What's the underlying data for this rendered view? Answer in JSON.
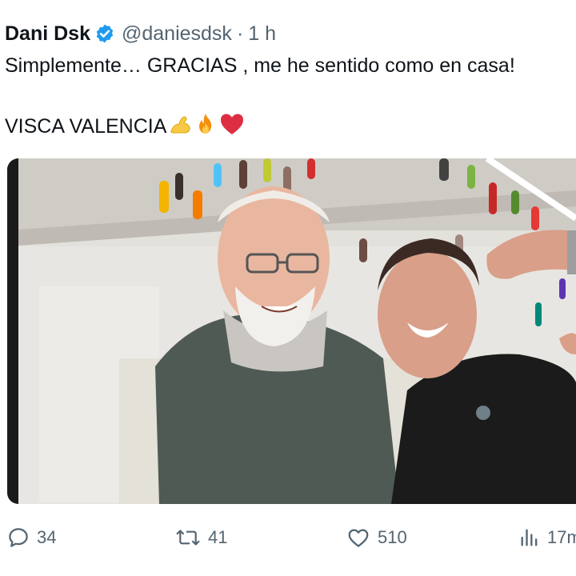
{
  "tweet": {
    "author_name": "Dani Dsk",
    "handle": "@daniesdsk",
    "separator": "·",
    "time": "1 h",
    "text_line1": "Simplemente… GRACIAS , me he sentido como en casa!",
    "text_line2": "VISCA VALENCIA",
    "emojis": [
      "flexed-biceps-icon",
      "fire-icon",
      "red-heart-icon"
    ]
  },
  "media": {
    "description_icon": "photo"
  },
  "actions": {
    "replies": "34",
    "reposts": "41",
    "likes": "510",
    "views": "17m"
  },
  "colors": {
    "text": "#0f1419",
    "secondary": "#536471",
    "verified": "#1d9bf0",
    "heart": "#e0245e"
  }
}
